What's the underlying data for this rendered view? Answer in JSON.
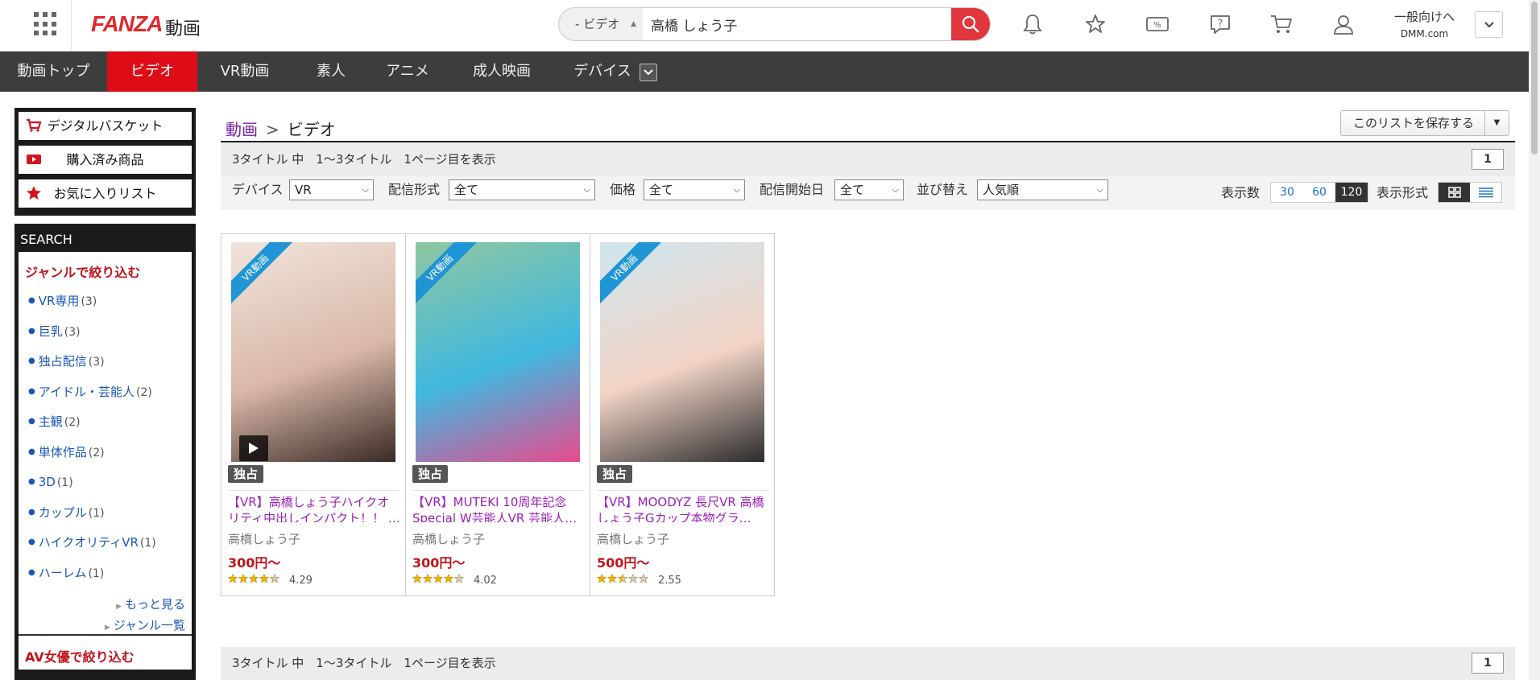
{
  "header": {
    "logo": "FANZA",
    "logo_sub": "動画",
    "search": {
      "category": "ビデオ",
      "query": "高橋 しょう子"
    },
    "account": {
      "label": "一般向けへ",
      "sub": "DMM.com"
    }
  },
  "nav": {
    "items": [
      "動画トップ",
      "ビデオ",
      "VR動画",
      "素人",
      "アニメ",
      "成人映画",
      "デバイス"
    ]
  },
  "sidebar": {
    "basket": "デジタルバスケット",
    "purchased": "購入済み商品",
    "favorites": "お気に入りリスト",
    "search_title": "SEARCH",
    "genre_heading": "ジャンルで絞り込む",
    "genres": [
      {
        "name": "VR専用",
        "count": "(3)"
      },
      {
        "name": "巨乳",
        "count": "(3)"
      },
      {
        "name": "独占配信",
        "count": "(3)"
      },
      {
        "name": "アイドル・芸能人",
        "count": "(2)"
      },
      {
        "name": "主観",
        "count": "(2)"
      },
      {
        "name": "単体作品",
        "count": "(2)"
      },
      {
        "name": "3D",
        "count": "(1)"
      },
      {
        "name": "カップル",
        "count": "(1)"
      },
      {
        "name": "ハイクオリティVR",
        "count": "(1)"
      },
      {
        "name": "ハーレム",
        "count": "(1)"
      }
    ],
    "more": "もっと見る",
    "genre_list": "ジャンル一覧",
    "actress_heading": "AV女優で絞り込む"
  },
  "main": {
    "breadcrumb": {
      "root": "動画",
      "current": "ビデオ"
    },
    "save_list": "このリストを保存する",
    "result_info": "3タイトル 中　1～3タイトル　1ページ目を表示",
    "page": "1",
    "filters": {
      "device_label": "デバイス",
      "device_value": "VR",
      "format_label": "配信形式",
      "format_value": "全て",
      "price_label": "価格",
      "price_value": "全て",
      "start_label": "配信開始日",
      "start_value": "全て",
      "sort_label": "並び替え",
      "sort_value": "人気順",
      "count_label": "表示数",
      "counts": [
        "30",
        "60",
        "120"
      ],
      "view_label": "表示形式"
    }
  },
  "products": [
    {
      "ribbon": "VR動画",
      "badge": "独占",
      "title": "【VR】高橋しょう子ハイクオリティ中出しインパクト！！ …",
      "actress": "高橋しょう子",
      "price": "300円～",
      "rating": 4.29,
      "score": "4.29",
      "colors": [
        "#f0e4dc",
        "#d9b8a8",
        "#3a2a25"
      ]
    },
    {
      "ribbon": "VR動画",
      "badge": "独占",
      "title": "【VR】MUTEKI 10周年記念Special W芸能人VR 芸能人…",
      "actress": "高橋しょう子",
      "price": "300円～",
      "rating": 4.02,
      "score": "4.02",
      "colors": [
        "#8fc7a0",
        "#40b8e0",
        "#e84a8c"
      ]
    },
    {
      "ribbon": "VR動画",
      "badge": "独占",
      "title": "【VR】MOODYZ 長尺VR 高橋しょう子Gカップ本物グラ…",
      "actress": "高橋しょう子",
      "price": "500円～",
      "rating": 2.55,
      "score": "2.55",
      "colors": [
        "#cfe6ef",
        "#f2d4c6",
        "#2b2b2b"
      ]
    }
  ]
}
